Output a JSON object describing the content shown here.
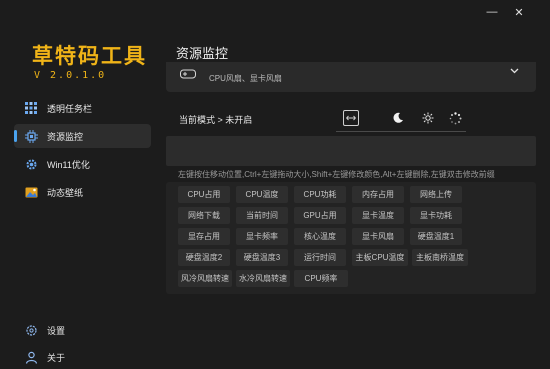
{
  "app": {
    "logo_text": "草特码工具",
    "version": "V 2.0.1.0"
  },
  "window_controls": {
    "minimize": "—",
    "close": "✕"
  },
  "sidebar": {
    "items": [
      {
        "label": "透明任务栏",
        "icon": "taskbar-grid-icon"
      },
      {
        "label": "资源监控",
        "icon": "chip-icon",
        "active": true
      },
      {
        "label": "Win11优化",
        "icon": "gear-icon"
      },
      {
        "label": "动态壁纸",
        "icon": "wallpaper-icon"
      }
    ],
    "bottom_items": [
      {
        "label": "设置",
        "icon": "settings-icon"
      },
      {
        "label": "关于",
        "icon": "user-icon"
      }
    ]
  },
  "main": {
    "title": "资源监控",
    "card": {
      "subtitle": "CPU风扇、显卡风扇",
      "icon": "gamepad-icon",
      "expand_icon": "chevron-down-icon"
    },
    "mode_label": "当前模式 > 未开启",
    "tools": [
      {
        "name": "resize-icon",
        "symbol": "↔"
      },
      {
        "name": "moon-icon",
        "symbol": "☾"
      },
      {
        "name": "sun-icon",
        "symbol": "☼"
      },
      {
        "name": "loading-icon",
        "symbol": "⁘"
      }
    ],
    "hint": "左键按住移动位置,Ctrl+左键拖动大小,Shift+左键修改颜色,Alt+左键删除,左键双击修改前缀",
    "chips": [
      [
        "CPU占用",
        "CPU温度",
        "CPU功耗",
        "内存占用",
        "网络上传"
      ],
      [
        "网络下载",
        "当前时间",
        "GPU占用",
        "显卡温度",
        "显卡功耗"
      ],
      [
        "显存占用",
        "显卡频率",
        "核心温度",
        "显卡风扇",
        "硬盘温度1"
      ],
      [
        "硬盘温度2",
        "硬盘温度3",
        "运行时间",
        "主板CPU温度",
        "主板南桥温度"
      ],
      [
        "风冷风扇转速",
        "水冷风扇转速",
        "CPU频率"
      ]
    ]
  },
  "colors": {
    "accent": "#4aa3f0",
    "logo": "#f0b418",
    "background": "#1c1c1c"
  }
}
